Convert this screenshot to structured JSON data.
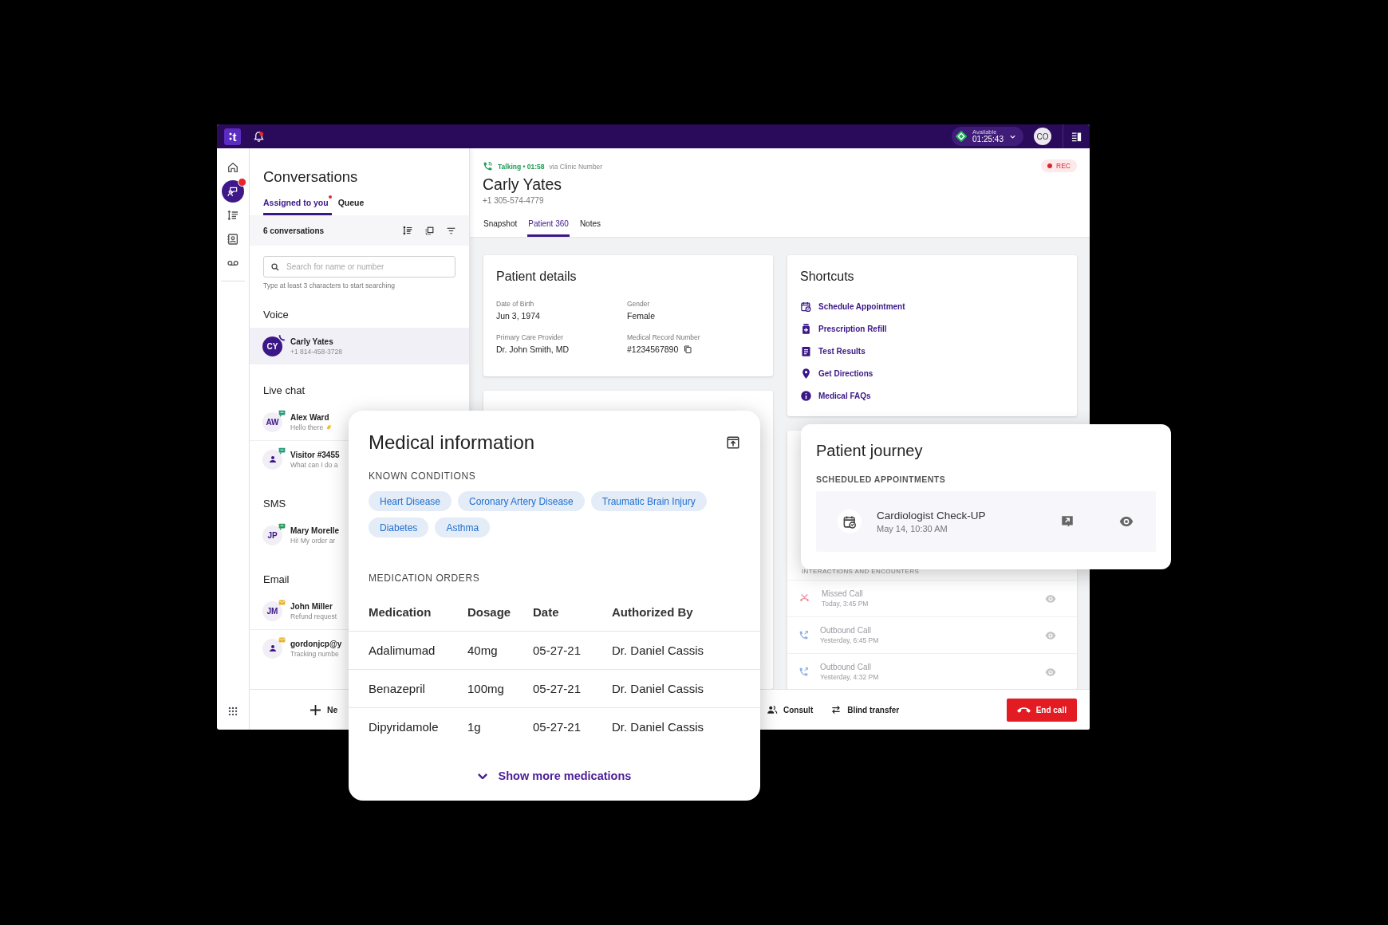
{
  "topbar": {
    "logo": "t",
    "notification_dot": true,
    "status": {
      "label": "Available",
      "timer": "01:25:43"
    },
    "avatar": "CO"
  },
  "rail": [
    {
      "kind": "home",
      "selected": false,
      "badge": false
    },
    {
      "kind": "conversations",
      "selected": true,
      "badge": true
    },
    {
      "kind": "list",
      "selected": false,
      "badge": false
    },
    {
      "kind": "contacts",
      "selected": false,
      "badge": false
    },
    {
      "kind": "voicemail",
      "selected": false,
      "badge": false
    }
  ],
  "conversations": {
    "title": "Conversations",
    "tabs": [
      {
        "label": "Assigned to you",
        "selected": true,
        "dot": true
      },
      {
        "label": "Queue",
        "selected": false,
        "dot": false
      }
    ],
    "count": "6 conversations",
    "search": {
      "placeholder": "Search for name or number"
    },
    "hint": "Type at least 3 characters to start searching",
    "groups": [
      {
        "title": "Voice",
        "items": [
          {
            "avatar": {
              "kind": "initials",
              "text": "CY"
            },
            "kind": "voice",
            "name": "Carly Yates",
            "preview": "+1 814-458-3728",
            "emoji": false,
            "selected": true
          }
        ]
      },
      {
        "title": "Live chat",
        "items": [
          {
            "avatar": {
              "kind": "initials",
              "text": "AW"
            },
            "kind": "chat",
            "name": "Alex Ward",
            "preview": "Hello there",
            "emoji": true,
            "selected": false
          },
          {
            "avatar": {
              "kind": "person"
            },
            "kind": "chat",
            "name": "Visitor #3455",
            "preview": "What can I do a",
            "emoji": false,
            "selected": false
          }
        ]
      },
      {
        "title": "SMS",
        "items": [
          {
            "avatar": {
              "kind": "initials",
              "text": "JP"
            },
            "kind": "sms",
            "name": "Mary Morelle",
            "preview": "Hi! My order ar",
            "emoji": false,
            "selected": false
          }
        ]
      },
      {
        "title": "Email",
        "items": [
          {
            "avatar": {
              "kind": "initials",
              "text": "JM"
            },
            "kind": "email",
            "name": "John Miller",
            "preview": "Refund request",
            "emoji": false,
            "selected": false
          },
          {
            "avatar": {
              "kind": "person"
            },
            "kind": "email",
            "name": "gordonjcp@y",
            "preview": "Tracking numbe",
            "emoji": false,
            "selected": false
          }
        ]
      }
    ],
    "new_button": "Ne"
  },
  "call": {
    "status": "Talking • 01:58",
    "via": "via Clinic Number",
    "recording": "REC",
    "name": "Carly Yates",
    "phone": "+1 305-574-4779",
    "tabs": [
      {
        "label": "Snapshot",
        "selected": false
      },
      {
        "label": "Patient 360",
        "selected": true
      },
      {
        "label": "Notes",
        "selected": false
      }
    ],
    "patient_details": {
      "title": "Patient details",
      "fields": [
        {
          "label": "Date of Birth",
          "value": "Jun 3, 1974",
          "copy": false
        },
        {
          "label": "Gender",
          "value": "Female",
          "copy": false
        },
        {
          "label": "Primary Care Provider",
          "value": "Dr. John Smith, MD",
          "copy": false
        },
        {
          "label": "Medical Record Number",
          "value": "#1234567890",
          "copy": true
        }
      ]
    },
    "shortcuts": {
      "title": "Shortcuts",
      "items": [
        {
          "kind": "calendar",
          "label": "Schedule Appointment"
        },
        {
          "kind": "pill",
          "label": "Prescription Refill"
        },
        {
          "kind": "clipboard",
          "label": "Test Results"
        },
        {
          "kind": "pin",
          "label": "Get Directions"
        },
        {
          "kind": "info",
          "label": "Medical FAQs"
        }
      ]
    },
    "interactions": {
      "title": "INTERACTIONS AND ENCOUNTERS",
      "items": [
        {
          "kind": "missed",
          "title": "Missed Call",
          "time": "Today, 3:45 PM"
        },
        {
          "kind": "outbound",
          "title": "Outbound Call",
          "time": "Yesterday, 6:45 PM"
        },
        {
          "kind": "outbound",
          "title": "Outbound Call",
          "time": "Yesterday, 4:32 PM"
        }
      ]
    },
    "actions": [
      {
        "kind": "consult",
        "label": "Consult"
      },
      {
        "kind": "transfer",
        "label": "Blind transfer"
      },
      {
        "kind": "end",
        "label": "End call"
      }
    ]
  },
  "medical": {
    "title": "Medical information",
    "conditions_title": "KNOWN CONDITIONS",
    "conditions": [
      "Heart Disease",
      "Coronary Artery Disease",
      "Traumatic Brain Injury",
      "Diabetes",
      "Asthma"
    ],
    "orders_title": "MEDICATION ORDERS",
    "columns": [
      "Medication",
      "Dosage",
      "Date",
      "Authorized By"
    ],
    "rows": [
      [
        "Adalimumad",
        "40mg",
        "05-27-21",
        "Dr. Daniel Cassis"
      ],
      [
        "Benazepril",
        "100mg",
        "05-27-21",
        "Dr. Daniel Cassis"
      ],
      [
        "Dipyridamole",
        "1g",
        "05-27-21",
        "Dr. Daniel Cassis"
      ]
    ],
    "show_more": "Show more medications"
  },
  "journey": {
    "title": "Patient journey",
    "section": "SCHEDULED APPOINTMENTS",
    "appointments": [
      {
        "title": "Cardiologist Check-UP",
        "time": "May 14, 10:30 AM"
      }
    ]
  }
}
